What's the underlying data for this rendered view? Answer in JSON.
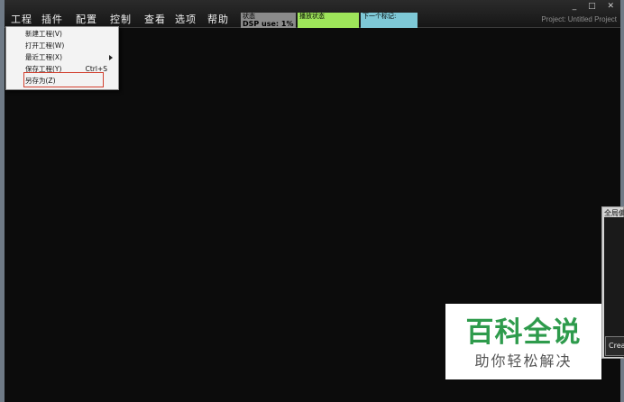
{
  "window": {
    "controls": "_ □ ✕",
    "project_title": "Project: Untitled Project"
  },
  "menubar": {
    "items": [
      "工程",
      "插件",
      "配置",
      "控制",
      "查看",
      "选项",
      "帮助"
    ]
  },
  "meters": {
    "dsp_caption": "状态",
    "dsp_value": "DSP use: 1%",
    "status_green": "播放状态",
    "status_cyan": "下一个标记:",
    "colors": {
      "dsp": "#8a8a8a",
      "green": "#9ee55a",
      "cyan": "#7ec8d6"
    }
  },
  "dropdown": {
    "items": [
      {
        "label": "新建工程(V)",
        "shortcut": "",
        "submenu": false
      },
      {
        "label": "打开工程(W)",
        "shortcut": "",
        "submenu": false
      },
      {
        "label": "最近工程(X)",
        "shortcut": "",
        "submenu": true
      },
      {
        "label": "保存工程(Y)",
        "shortcut": "Ctrl+S",
        "submenu": false
      },
      {
        "label": "另存为(Z)",
        "shortcut": "",
        "submenu": false
      }
    ],
    "highlight_color": "#d2402f"
  },
  "side_panel": {
    "title": "全局偏",
    "button_label": "Crea"
  },
  "watermark": {
    "title": "百科全说",
    "subtitle": "助你轻松解决",
    "title_color": "#2e9b4c"
  }
}
